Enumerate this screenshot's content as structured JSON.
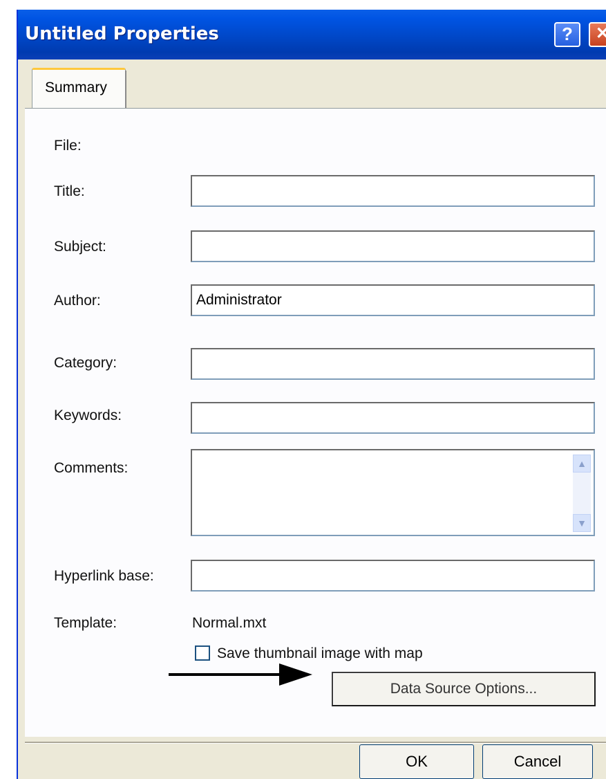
{
  "window": {
    "title": "Untitled Properties",
    "help_glyph": "?",
    "close_glyph": "✕"
  },
  "tabs": [
    {
      "label": "Summary",
      "active": true
    }
  ],
  "form": {
    "file_label": "File:",
    "title_label": "Title:",
    "title_value": "",
    "subject_label": "Subject:",
    "subject_value": "",
    "author_label": "Author:",
    "author_value": "Administrator",
    "category_label": "Category:",
    "category_value": "",
    "keywords_label": "Keywords:",
    "keywords_value": "",
    "comments_label": "Comments:",
    "comments_value": "",
    "hyperlink_label": "Hyperlink base:",
    "hyperlink_value": "",
    "template_label": "Template:",
    "template_value": "Normal.mxt",
    "thumbnail_label": "Save thumbnail image with map",
    "thumbnail_checked": false
  },
  "buttons": {
    "data_source_options": "Data Source Options...",
    "ok": "OK",
    "cancel": "Cancel"
  },
  "colors": {
    "titlebar": "#0054e3",
    "dialog_bg": "#ece9d8",
    "tab_highlight": "#ffc83c",
    "close_button": "#c8421e"
  }
}
